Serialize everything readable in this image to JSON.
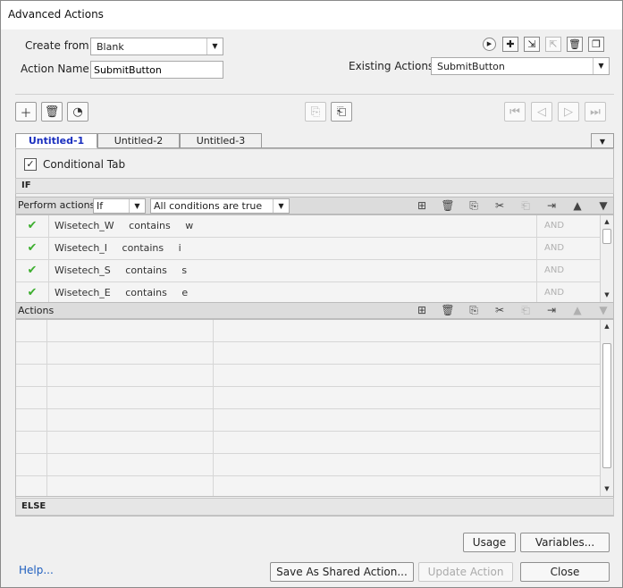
{
  "window": {
    "title": "Advanced Actions"
  },
  "create_from": {
    "label": "Create from:",
    "value": "Blank"
  },
  "action_name": {
    "label": "Action Name:",
    "value": "SubmitButton"
  },
  "existing_actions": {
    "label": "Existing Actions:",
    "value": "SubmitButton"
  },
  "tabs": [
    {
      "label": "Untitled-1",
      "active": true
    },
    {
      "label": "Untitled-2",
      "active": false
    },
    {
      "label": "Untitled-3",
      "active": false
    }
  ],
  "conditional": {
    "label": "Conditional Tab",
    "checked": true
  },
  "if_section": {
    "label": "IF"
  },
  "perform": {
    "label": "Perform actions:",
    "mode": "If",
    "condition": "All conditions are true"
  },
  "conditions": [
    {
      "variable": "Wisetech_W",
      "operator": "contains",
      "value": "w",
      "join": "AND"
    },
    {
      "variable": "Wisetech_I",
      "operator": "contains",
      "value": "i",
      "join": "AND"
    },
    {
      "variable": "Wisetech_S",
      "operator": "contains",
      "value": "s",
      "join": "AND"
    },
    {
      "variable": "Wisetech_E",
      "operator": "contains",
      "value": "e",
      "join": "AND"
    }
  ],
  "actions_section": {
    "label": "Actions",
    "rows": 8
  },
  "else_section": {
    "label": "ELSE"
  },
  "buttons": {
    "usage": "Usage",
    "variables": "Variables...",
    "help": "Help...",
    "save_shared": "Save As Shared Action...",
    "update": "Update Action",
    "close": "Close"
  },
  "icons": {
    "preview": "play-icon",
    "add": "plus-icon",
    "import": "import-icon",
    "export": "export-icon",
    "delete": "trash-icon",
    "duplicate": "duplicate-icon"
  }
}
